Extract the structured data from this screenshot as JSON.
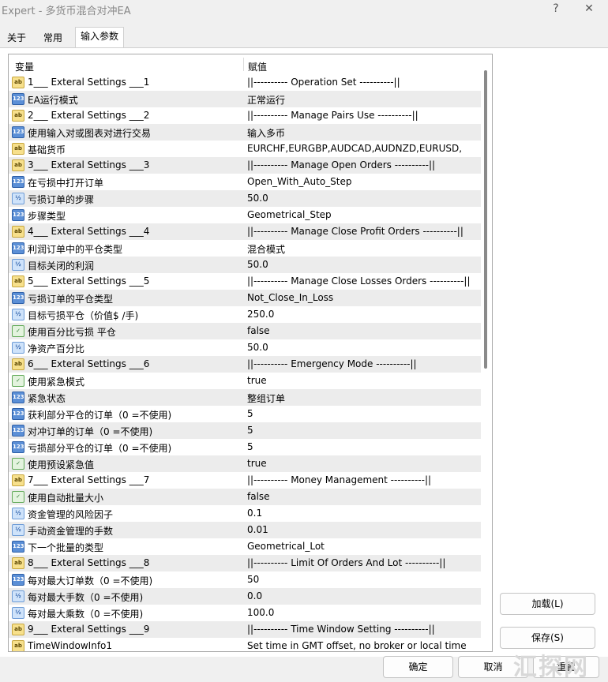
{
  "window": {
    "title": "Expert - 多货币混合对冲EA",
    "help_label": "?",
    "close_label": "✕"
  },
  "tabs": [
    {
      "label": "关于",
      "active": false
    },
    {
      "label": "常用",
      "active": false
    },
    {
      "label": "输入参数",
      "active": true
    }
  ],
  "grid": {
    "col_variable": "变量",
    "col_value": "赋值",
    "rows": [
      {
        "icon": "ab",
        "name": "1___ Exteral Settings ___1",
        "value": "||---------- Operation Set ----------||"
      },
      {
        "icon": "123",
        "name": "EA运行模式",
        "value": "正常运行"
      },
      {
        "icon": "ab",
        "name": "2___ Exteral Settings ___2",
        "value": "||---------- Manage Pairs Use ----------||"
      },
      {
        "icon": "123",
        "name": "使用输入对或图表对进行交易",
        "value": "输入多币"
      },
      {
        "icon": "ab",
        "name": "基础货币",
        "value": "EURCHF,EURGBP,AUDCAD,AUDNZD,EURUSD,"
      },
      {
        "icon": "ab",
        "name": "3___ Exteral Settings ___3",
        "value": "||---------- Manage Open Orders ----------||"
      },
      {
        "icon": "123",
        "name": "在亏损中打开订单",
        "value": "Open_With_Auto_Step"
      },
      {
        "icon": "half",
        "name": "亏损订单的步骤",
        "value": "50.0"
      },
      {
        "icon": "123",
        "name": "步骤类型",
        "value": "Geometrical_Step"
      },
      {
        "icon": "ab",
        "name": "4___ Exteral Settings ___4",
        "value": "||---------- Manage Close Profit Orders ----------||"
      },
      {
        "icon": "123",
        "name": "利润订单中的平仓类型",
        "value": "混合模式"
      },
      {
        "icon": "half",
        "name": "目标关闭的利润",
        "value": "50.0"
      },
      {
        "icon": "ab",
        "name": "5___ Exteral Settings ___5",
        "value": "||---------- Manage Close Losses Orders ----------||"
      },
      {
        "icon": "123",
        "name": "亏损订单的平仓类型",
        "value": "Not_Close_In_Loss"
      },
      {
        "icon": "half",
        "name": "目标亏损平仓（价值$ /手)",
        "value": "250.0"
      },
      {
        "icon": "bool",
        "name": "使用百分比亏损 平仓",
        "value": "false"
      },
      {
        "icon": "half",
        "name": "净资产百分比",
        "value": "50.0"
      },
      {
        "icon": "ab",
        "name": "6___ Exteral Settings ___6",
        "value": "||---------- Emergency Mode ----------||"
      },
      {
        "icon": "bool",
        "name": "使用紧急模式",
        "value": "true"
      },
      {
        "icon": "123",
        "name": "紧急状态",
        "value": "整组订单"
      },
      {
        "icon": "123",
        "name": "获利部分平仓的订单（0 =不使用)",
        "value": "5"
      },
      {
        "icon": "123",
        "name": "对冲订单的订单（0 =不使用)",
        "value": "5"
      },
      {
        "icon": "123",
        "name": "亏损部分平仓的订单（0 =不使用)",
        "value": "5"
      },
      {
        "icon": "bool",
        "name": "使用预设紧急值",
        "value": "true"
      },
      {
        "icon": "ab",
        "name": "7___ Exteral Settings ___7",
        "value": "||---------- Money Management ----------||"
      },
      {
        "icon": "bool",
        "name": "使用自动批量大小",
        "value": "false"
      },
      {
        "icon": "half",
        "name": "资金管理的风险因子",
        "value": "0.1"
      },
      {
        "icon": "half",
        "name": "手动资金管理的手数",
        "value": "0.01"
      },
      {
        "icon": "123",
        "name": "下一个批量的类型",
        "value": "Geometrical_Lot"
      },
      {
        "icon": "ab",
        "name": "8___ Exteral Settings ___8",
        "value": "||---------- Limit Of Orders And Lot ----------||"
      },
      {
        "icon": "123",
        "name": "每对最大订单数（0 =不使用)",
        "value": "50"
      },
      {
        "icon": "half",
        "name": "每对最大手数（0 =不使用)",
        "value": "0.0"
      },
      {
        "icon": "half",
        "name": "每对最大乘数（0 =不使用)",
        "value": "100.0"
      },
      {
        "icon": "ab",
        "name": "9___ Exteral Settings ___9",
        "value": "||---------- Time Window Setting ----------||"
      },
      {
        "icon": "ab",
        "name": "TimeWindowInfo1",
        "value": "Set time in GMT offset, no broker or local time"
      }
    ]
  },
  "icon_labels": {
    "ab": "ab",
    "123": "123",
    "half": "½",
    "bool": "✓"
  },
  "buttons": {
    "load": "加载(L)",
    "save": "保存(S)",
    "ok": "确定",
    "cancel": "取消",
    "reset": "重置"
  },
  "watermark": "汇探网"
}
